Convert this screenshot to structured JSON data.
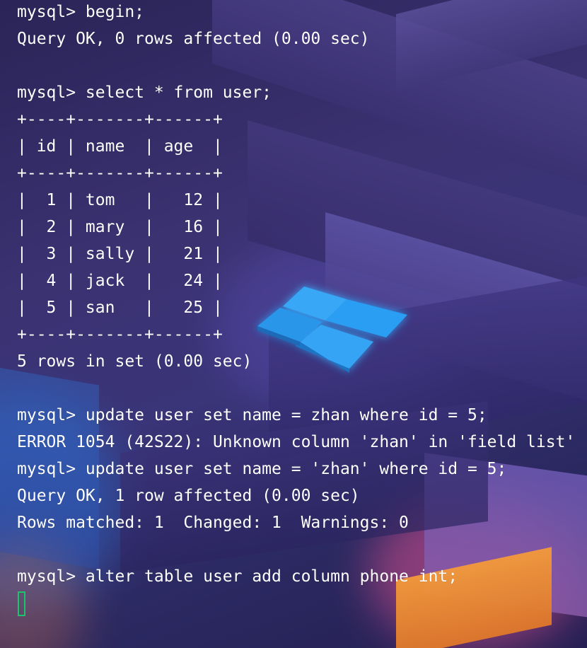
{
  "terminal": {
    "lines": [
      "mysql> begin;",
      "Query OK, 0 rows affected (0.00 sec)",
      "",
      "mysql> select * from user;",
      "+----+-------+------+",
      "| id | name  | age  |",
      "+----+-------+------+",
      "|  1 | tom   |   12 |",
      "|  2 | mary  |   16 |",
      "|  3 | sally |   21 |",
      "|  4 | jack  |   24 |",
      "|  5 | san   |   25 |",
      "+----+-------+------+",
      "5 rows in set (0.00 sec)",
      "",
      "mysql> update user set name = zhan where id = 5;",
      "ERROR 1054 (42S22): Unknown column 'zhan' in 'field list'",
      "mysql> update user set name = 'zhan' where id = 5;",
      "Query OK, 1 row affected (0.00 sec)",
      "Rows matched: 1  Changed: 1  Warnings: 0",
      "",
      "mysql> alter table user add column phone int;"
    ],
    "text_color": "#ffffff",
    "cursor_color": "#19c46a"
  },
  "wallpaper": {
    "logo_color": "#2a9df4",
    "accent_orange": "#f08a2a",
    "accent_pink": "#e0609a"
  }
}
